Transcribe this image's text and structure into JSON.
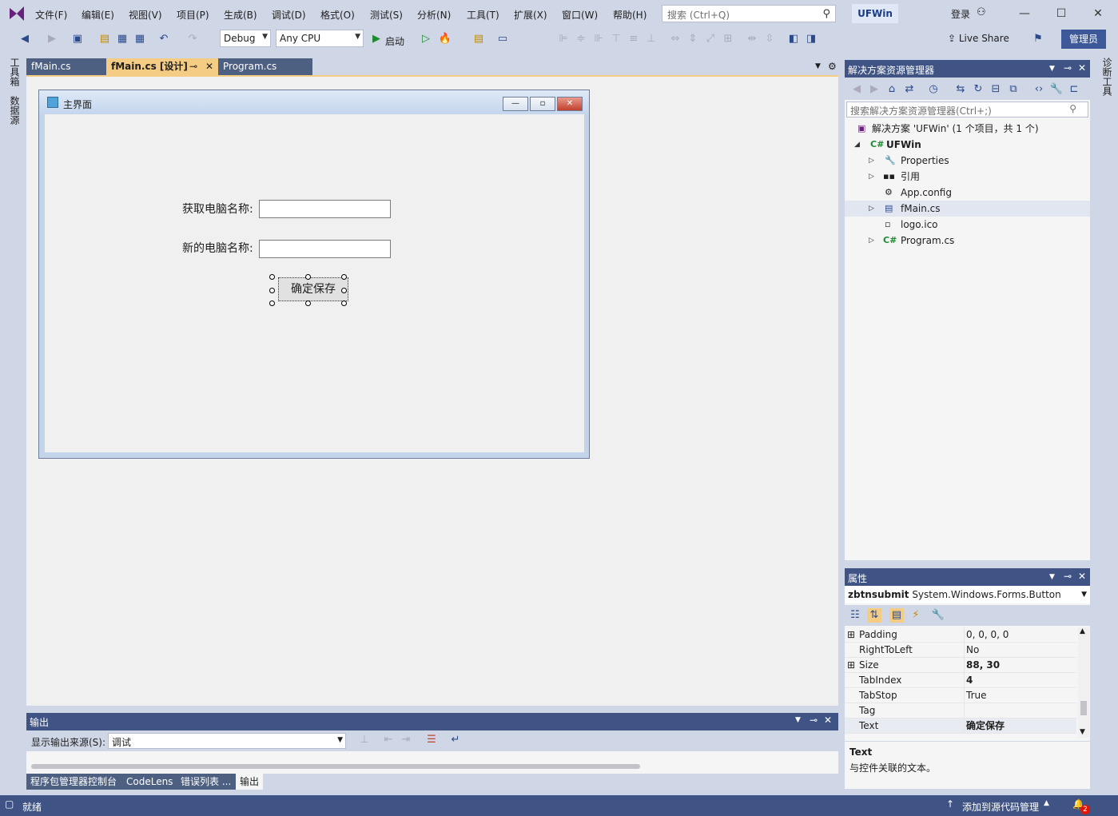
{
  "menu": {
    "items": [
      "文件(F)",
      "编辑(E)",
      "视图(V)",
      "项目(P)",
      "生成(B)",
      "调试(D)",
      "格式(O)",
      "测试(S)",
      "分析(N)",
      "工具(T)",
      "扩展(X)",
      "窗口(W)",
      "帮助(H)"
    ],
    "search_placeholder": "搜索 (Ctrl+Q)",
    "solution_name": "UFWin",
    "login": "登录"
  },
  "toolbar": {
    "config": "Debug",
    "platform": "Any CPU",
    "run_label": "启动",
    "liveshare": "Live Share",
    "admin": "管理员"
  },
  "left_rail": {
    "toolbox": "工具箱",
    "datasource": "数据源"
  },
  "right_rail": {
    "diag": "诊断工具"
  },
  "tabs": {
    "fmain": "fMain.cs",
    "design": "fMain.cs [设计]",
    "program": "Program.cs"
  },
  "form": {
    "title": "主界面",
    "label_get": "获取电脑名称:",
    "label_new": "新的电脑名称:",
    "submit": "确定保存"
  },
  "output": {
    "title": "输出",
    "source_label": "显示输出来源(S):",
    "source_value": "调试"
  },
  "bottom_tabs": [
    "程序包管理器控制台",
    "CodeLens",
    "错误列表 ...",
    "输出"
  ],
  "solution_explorer": {
    "title": "解决方案资源管理器",
    "search_placeholder": "搜索解决方案资源管理器(Ctrl+;)",
    "solution_line": "解决方案 'UFWin' (1 个项目，共 1 个)",
    "project": "UFWin",
    "items": [
      "Properties",
      "引用",
      "App.config",
      "fMain.cs",
      "logo.ico",
      "Program.cs"
    ]
  },
  "properties": {
    "title": "属性",
    "object_name": "zbtnsubmit",
    "object_type": "System.Windows.Forms.Button",
    "rows": [
      {
        "name": "Padding",
        "value": "0, 0, 0, 0"
      },
      {
        "name": "RightToLeft",
        "value": "No"
      },
      {
        "name": "Size",
        "value": "88, 30"
      },
      {
        "name": "TabIndex",
        "value": "4"
      },
      {
        "name": "TabStop",
        "value": "True"
      },
      {
        "name": "Tag",
        "value": ""
      },
      {
        "name": "Text",
        "value": "确定保存"
      }
    ],
    "desc_title": "Text",
    "desc_text": "与控件关联的文本。"
  },
  "status": {
    "ready": "就绪",
    "source_control": "添加到源代码管理",
    "notification_count": "2"
  },
  "colors": {
    "accent": "#3f5484",
    "tab_active": "#f5cc84"
  }
}
